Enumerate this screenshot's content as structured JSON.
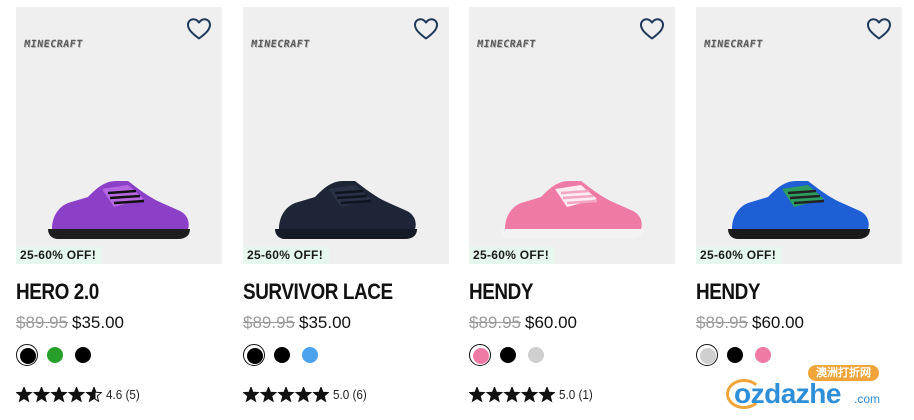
{
  "products": [
    {
      "brand_logo": "MINECRAFT",
      "badge": "25-60% OFF!",
      "name": "HERO 2.0",
      "was_price": "$89.95",
      "price": "$35.00",
      "wishlist_icon": "heart-outline-icon",
      "shoe_colors": {
        "body": "#8c3fc7",
        "accent": "#c06ee8",
        "sole": "#1e1e1e",
        "lace": "#111111"
      },
      "swatches": [
        {
          "color": "#000000",
          "selected": true
        },
        {
          "color": "#27a02b",
          "selected": false
        },
        {
          "color": "#000000",
          "selected": false
        }
      ],
      "rating": {
        "stars": 4.6,
        "score": "4.6",
        "count": "(5)"
      }
    },
    {
      "brand_logo": "MINECRAFT",
      "badge": "25-60% OFF!",
      "name": "SURVIVOR LACE",
      "was_price": "$89.95",
      "price": "$35.00",
      "wishlist_icon": "heart-outline-icon",
      "shoe_colors": {
        "body": "#1d2536",
        "accent": "#2a3448",
        "sole": "#141a26",
        "lace": "#0f1520"
      },
      "swatches": [
        {
          "color": "#000000",
          "selected": true
        },
        {
          "color": "#000000",
          "selected": false
        },
        {
          "color": "#4aa3ec",
          "selected": false
        }
      ],
      "rating": {
        "stars": 5.0,
        "score": "5.0",
        "count": "(6)"
      }
    },
    {
      "brand_logo": "MINECRAFT",
      "badge": "25-60% OFF!",
      "name": "HENDY",
      "was_price": "$89.95",
      "price": "$60.00",
      "wishlist_icon": "heart-outline-icon",
      "shoe_colors": {
        "body": "#f07aa6",
        "accent": "#ffffff",
        "sole": "#f3f3f3",
        "lace": "#f2a6c4"
      },
      "swatches": [
        {
          "color": "#f07aa6",
          "selected": true
        },
        {
          "color": "#000000",
          "selected": false
        },
        {
          "color": "#cfcfcf",
          "selected": false
        }
      ],
      "rating": {
        "stars": 5.0,
        "score": "5.0",
        "count": "(1)"
      }
    },
    {
      "brand_logo": "MINECRAFT",
      "badge": "25-60% OFF!",
      "name": "HENDY",
      "was_price": "$89.95",
      "price": "$60.00",
      "wishlist_icon": "heart-outline-icon",
      "shoe_colors": {
        "body": "#1f5fd6",
        "accent": "#2fa84a",
        "sole": "#1a1a1a",
        "lace": "#222222"
      },
      "swatches": [
        {
          "color": "#cfcfcf",
          "selected": true
        },
        {
          "color": "#000000",
          "selected": false
        },
        {
          "color": "#f07aa6",
          "selected": false
        }
      ],
      "rating": null
    }
  ],
  "watermark": {
    "top": "澳洲打折网",
    "main": "ozdazhe",
    "suffix": ".com"
  },
  "colors": {
    "badge_bg": "#e6f7ee",
    "card_bg": "#efefef",
    "heart": "#1f3a5a",
    "star": "#111111"
  }
}
